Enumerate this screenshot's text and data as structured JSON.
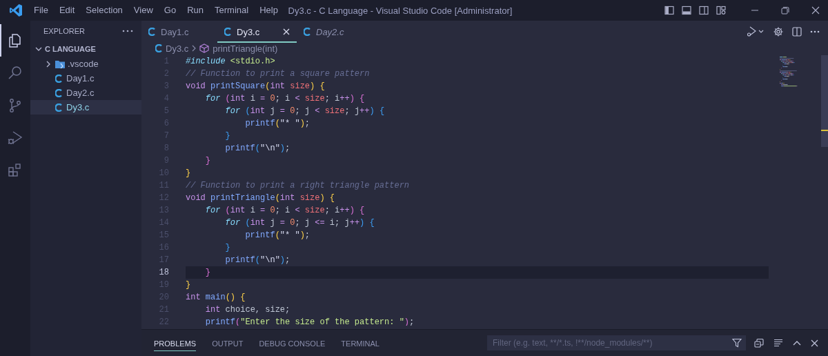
{
  "title_bar": {
    "menu": [
      "File",
      "Edit",
      "Selection",
      "View",
      "Go",
      "Run",
      "Terminal",
      "Help"
    ],
    "title": "Dy3.c - C Language - Visual Studio Code [Administrator]"
  },
  "activity_bar": {
    "items": [
      {
        "kind": "files",
        "selected": true
      },
      {
        "kind": "search",
        "selected": false
      },
      {
        "kind": "source-control",
        "selected": false
      },
      {
        "kind": "run-debug",
        "selected": false
      },
      {
        "kind": "extensions",
        "selected": false
      }
    ]
  },
  "sidebar": {
    "title": "EXPLORER",
    "tree": {
      "label": "C LANGUAGE",
      "expanded": true,
      "children": [
        {
          "label": ".vscode",
          "kind": "folder",
          "expanded": false,
          "selected": false
        },
        {
          "label": "Day1.c",
          "kind": "c-file",
          "selected": false
        },
        {
          "label": "Day2.c",
          "kind": "c-file",
          "selected": false
        },
        {
          "label": "Dy3.c",
          "kind": "c-file",
          "selected": true
        }
      ]
    }
  },
  "tabs": [
    {
      "label": "Day1.c",
      "selected": false,
      "preview": false
    },
    {
      "label": "Dy3.c",
      "selected": true,
      "preview": false
    },
    {
      "label": "Day2.c",
      "selected": false,
      "preview": true
    }
  ],
  "breadcrumb": {
    "file": "Dy3.c",
    "symbol": "printTriangle(int)"
  },
  "editor": {
    "lines": [
      {
        "number": "1",
        "current": false,
        "tokens": [
          {
            "kind": "directive",
            "text": "#include"
          },
          {
            "kind": "header",
            "text": " <stdio.h>"
          }
        ]
      },
      {
        "number": "2",
        "current": false,
        "tokens": [
          {
            "kind": "comment",
            "text": "// Function to print a square pattern"
          }
        ]
      },
      {
        "number": "3",
        "current": false,
        "tokens": [
          {
            "kind": "type",
            "text": "void"
          },
          {
            "kind": "function",
            "text": " printSquare"
          },
          {
            "kind": "bracket1",
            "text": "("
          },
          {
            "kind": "type",
            "text": "int"
          },
          {
            "kind": "param",
            "text": " size"
          },
          {
            "kind": "bracket1",
            "text": ")"
          },
          {
            "kind": "bracket1",
            "text": " {"
          }
        ]
      },
      {
        "number": "4",
        "current": false,
        "tokens": [
          {
            "kind": "control",
            "text": "    for"
          },
          {
            "kind": "bracket2",
            "text": " ("
          },
          {
            "kind": "type",
            "text": "int"
          },
          {
            "kind": "plain",
            "text": " i "
          },
          {
            "kind": "operator",
            "text": "="
          },
          {
            "kind": "number",
            "text": " 0"
          },
          {
            "kind": "plain",
            "text": "; i "
          },
          {
            "kind": "operator",
            "text": "<"
          },
          {
            "kind": "param",
            "text": " size"
          },
          {
            "kind": "plain",
            "text": "; i"
          },
          {
            "kind": "operator",
            "text": "++"
          },
          {
            "kind": "bracket2",
            "text": ")"
          },
          {
            "kind": "bracket2",
            "text": " {"
          }
        ]
      },
      {
        "number": "5",
        "current": false,
        "tokens": [
          {
            "kind": "control",
            "text": "        for"
          },
          {
            "kind": "bracket3",
            "text": " ("
          },
          {
            "kind": "type",
            "text": "int"
          },
          {
            "kind": "plain",
            "text": " j "
          },
          {
            "kind": "operator",
            "text": "="
          },
          {
            "kind": "number",
            "text": " 0"
          },
          {
            "kind": "plain",
            "text": "; j "
          },
          {
            "kind": "operator",
            "text": "<"
          },
          {
            "kind": "param",
            "text": " size"
          },
          {
            "kind": "plain",
            "text": "; j"
          },
          {
            "kind": "operator",
            "text": "++"
          },
          {
            "kind": "bracket3",
            "text": ")"
          },
          {
            "kind": "bracket3",
            "text": " {"
          }
        ]
      },
      {
        "number": "6",
        "current": false,
        "tokens": [
          {
            "kind": "function",
            "text": "            printf"
          },
          {
            "kind": "bracket1",
            "text": "("
          },
          {
            "kind": "literal",
            "text": "\"* \""
          },
          {
            "kind": "bracket1",
            "text": ")"
          },
          {
            "kind": "plain",
            "text": ";"
          }
        ]
      },
      {
        "number": "7",
        "current": false,
        "tokens": [
          {
            "kind": "bracket3",
            "text": "        }"
          }
        ]
      },
      {
        "number": "8",
        "current": false,
        "tokens": [
          {
            "kind": "function",
            "text": "        printf"
          },
          {
            "kind": "bracket3",
            "text": "("
          },
          {
            "kind": "literal",
            "text": "\"\\n\""
          },
          {
            "kind": "bracket3",
            "text": ")"
          },
          {
            "kind": "plain",
            "text": ";"
          }
        ]
      },
      {
        "number": "9",
        "current": false,
        "tokens": [
          {
            "kind": "bracket2",
            "text": "    }"
          }
        ]
      },
      {
        "number": "10",
        "current": false,
        "tokens": [
          {
            "kind": "bracket1",
            "text": "}"
          }
        ]
      },
      {
        "number": "11",
        "current": false,
        "tokens": [
          {
            "kind": "comment",
            "text": "// Function to print a right triangle pattern"
          }
        ]
      },
      {
        "number": "12",
        "current": false,
        "tokens": [
          {
            "kind": "type",
            "text": "void"
          },
          {
            "kind": "function",
            "text": " printTriangle"
          },
          {
            "kind": "bracket1",
            "text": "("
          },
          {
            "kind": "type",
            "text": "int"
          },
          {
            "kind": "param",
            "text": " size"
          },
          {
            "kind": "bracket1",
            "text": ")"
          },
          {
            "kind": "bracket1",
            "text": " {"
          }
        ]
      },
      {
        "number": "13",
        "current": false,
        "tokens": [
          {
            "kind": "control",
            "text": "    for"
          },
          {
            "kind": "bracket2",
            "text": " ("
          },
          {
            "kind": "type",
            "text": "int"
          },
          {
            "kind": "plain",
            "text": " i "
          },
          {
            "kind": "operator",
            "text": "="
          },
          {
            "kind": "number",
            "text": " 0"
          },
          {
            "kind": "plain",
            "text": "; i "
          },
          {
            "kind": "operator",
            "text": "<"
          },
          {
            "kind": "param",
            "text": " size"
          },
          {
            "kind": "plain",
            "text": "; i"
          },
          {
            "kind": "operator",
            "text": "++"
          },
          {
            "kind": "bracket2",
            "text": ")"
          },
          {
            "kind": "bracket2",
            "text": " {"
          }
        ]
      },
      {
        "number": "14",
        "current": false,
        "tokens": [
          {
            "kind": "control",
            "text": "        for"
          },
          {
            "kind": "bracket3",
            "text": " ("
          },
          {
            "kind": "type",
            "text": "int"
          },
          {
            "kind": "plain",
            "text": " j "
          },
          {
            "kind": "operator",
            "text": "="
          },
          {
            "kind": "number",
            "text": " 0"
          },
          {
            "kind": "plain",
            "text": "; j "
          },
          {
            "kind": "operator",
            "text": "<="
          },
          {
            "kind": "plain",
            "text": " i; j"
          },
          {
            "kind": "operator",
            "text": "++"
          },
          {
            "kind": "bracket3",
            "text": ")"
          },
          {
            "kind": "bracket3",
            "text": " {"
          }
        ]
      },
      {
        "number": "15",
        "current": false,
        "tokens": [
          {
            "kind": "function",
            "text": "            printf"
          },
          {
            "kind": "bracket1",
            "text": "("
          },
          {
            "kind": "literal",
            "text": "\"* \""
          },
          {
            "kind": "bracket1",
            "text": ")"
          },
          {
            "kind": "plain",
            "text": ";"
          }
        ]
      },
      {
        "number": "16",
        "current": false,
        "tokens": [
          {
            "kind": "bracket3",
            "text": "        }"
          }
        ]
      },
      {
        "number": "17",
        "current": false,
        "tokens": [
          {
            "kind": "function",
            "text": "        printf"
          },
          {
            "kind": "bracket3",
            "text": "("
          },
          {
            "kind": "literal",
            "text": "\"\\n\""
          },
          {
            "kind": "bracket3",
            "text": ")"
          },
          {
            "kind": "plain",
            "text": ";"
          }
        ]
      },
      {
        "number": "18",
        "current": true,
        "tokens": [
          {
            "kind": "bracket2",
            "text": "    }"
          }
        ]
      },
      {
        "number": "19",
        "current": false,
        "tokens": [
          {
            "kind": "bracket1",
            "text": "}"
          }
        ]
      },
      {
        "number": "20",
        "current": false,
        "tokens": [
          {
            "kind": "type",
            "text": "int"
          },
          {
            "kind": "function",
            "text": " main"
          },
          {
            "kind": "bracket1",
            "text": "()"
          },
          {
            "kind": "bracket1",
            "text": " {"
          }
        ]
      },
      {
        "number": "21",
        "current": false,
        "tokens": [
          {
            "kind": "type",
            "text": "    int"
          },
          {
            "kind": "plain",
            "text": " choice, size;"
          }
        ]
      },
      {
        "number": "22",
        "current": false,
        "tokens": [
          {
            "kind": "function",
            "text": "    printf"
          },
          {
            "kind": "bracket2",
            "text": "("
          },
          {
            "kind": "string",
            "text": "\"Enter the size of the pattern: \""
          },
          {
            "kind": "bracket2",
            "text": ")"
          },
          {
            "kind": "plain",
            "text": ";"
          }
        ]
      }
    ]
  },
  "panel": {
    "tabs": [
      {
        "label": "PROBLEMS",
        "selected": true
      },
      {
        "label": "OUTPUT",
        "selected": false
      },
      {
        "label": "DEBUG CONSOLE",
        "selected": false
      },
      {
        "label": "TERMINAL",
        "selected": false
      }
    ],
    "filter": {
      "placeholder": "Filter (e.g. text, **/*.ts, !**/node_modules/**)"
    }
  }
}
